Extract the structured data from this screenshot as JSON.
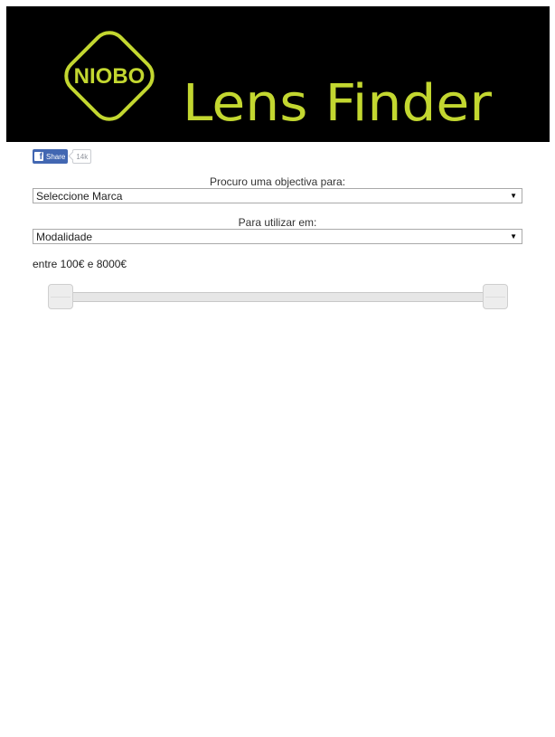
{
  "banner": {
    "logo_text": "NIOBO",
    "title": "Lens Finder",
    "background_color": "#000000",
    "accent_color": "#c3d730"
  },
  "share": {
    "button_label": "Share",
    "count": "14k",
    "icon": "facebook-icon",
    "color": "#4267b2"
  },
  "brand_section": {
    "label": "Procuro uma objectiva para:",
    "selected": "Seleccione Marca"
  },
  "use_section": {
    "label": "Para utilizar em:",
    "selected": "Modalidade"
  },
  "price": {
    "text": "entre 100€ e 8000€",
    "min": 100,
    "max": 8000,
    "currency": "€"
  }
}
